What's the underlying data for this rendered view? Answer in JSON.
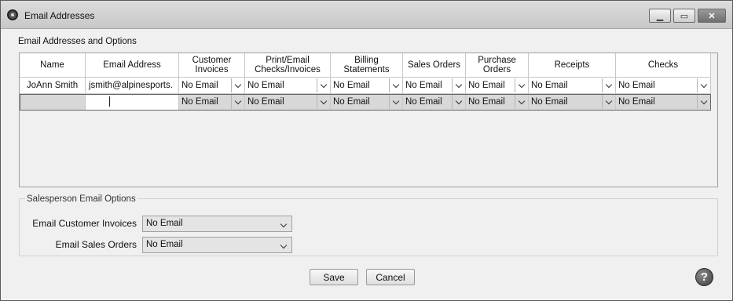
{
  "window": {
    "title": "Email Addresses"
  },
  "section_label": "Email Addresses and Options",
  "grid": {
    "headers": {
      "name": "Name",
      "email": "Email Address",
      "cust_inv_1": "Customer",
      "cust_inv_2": "Invoices",
      "print_1": "Print/Email",
      "print_2": "Checks/Invoices",
      "billing_1": "Billing",
      "billing_2": "Statements",
      "sales_orders": "Sales Orders",
      "po_1": "Purchase",
      "po_2": "Orders",
      "receipts": "Receipts",
      "checks": "Checks"
    },
    "rows": [
      {
        "name": "JoAnn Smith",
        "email": "jsmith@alpinesports.",
        "cust_inv": "No Email",
        "print": "No Email",
        "billing": "No Email",
        "sales_orders": "No Email",
        "po": "No Email",
        "receipts": "No Email",
        "checks": "No Email"
      },
      {
        "name": "",
        "email": "",
        "cust_inv": "No Email",
        "print": "No Email",
        "billing": "No Email",
        "sales_orders": "No Email",
        "po": "No Email",
        "receipts": "No Email",
        "checks": "No Email"
      }
    ]
  },
  "salesperson": {
    "group_title": "Salesperson Email Options",
    "invoices_label": "Email Customer Invoices",
    "invoices_value": "No Email",
    "orders_label": "Email Sales Orders",
    "orders_value": "No Email"
  },
  "buttons": {
    "save": "Save",
    "cancel": "Cancel",
    "help": "?"
  }
}
